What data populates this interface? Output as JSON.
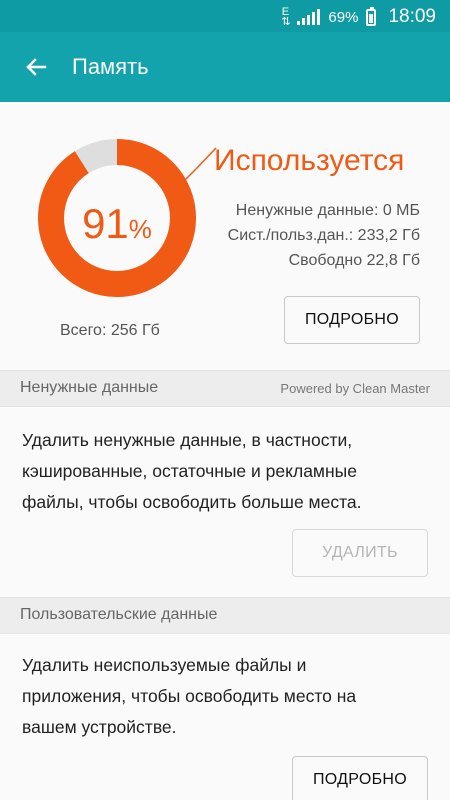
{
  "status_bar": {
    "network_type": "E",
    "battery_percent": "69%",
    "time": "18:09"
  },
  "app_bar": {
    "back_icon": "arrow-left-icon",
    "title": "Память"
  },
  "storage_summary": {
    "used_percent_value": 91,
    "used_percent_number": "91",
    "percent_sign": "%",
    "used_label": "Используется",
    "junk_data": "Ненужные данные: 0 МБ",
    "system_user_data": "Сист./польз.дан.: 233,2 Гб",
    "free": "Свободно 22,8 Гб",
    "total": "Всего: 256 Гб",
    "details_button": "ПОДРОБНО",
    "colors": {
      "used": "#f05a14",
      "remaining": "#dedede",
      "accent": "#12a3ad"
    }
  },
  "junk_section": {
    "title": "Ненужные данные",
    "powered_by": "Powered by Clean Master",
    "description_lines": [
      "Удалить ненужные данные, в частности,",
      "кэшированные, остаточные и рекламные",
      "файлы, чтобы освободить больше места."
    ],
    "delete_button": "УДАЛИТЬ",
    "delete_enabled": false
  },
  "user_section": {
    "title": "Пользовательские данные",
    "description_lines": [
      "Удалить неиспользуемые файлы и",
      "приложения, чтобы освободить место на",
      "вашем устройстве."
    ],
    "details_button": "ПОДРОБНО"
  }
}
